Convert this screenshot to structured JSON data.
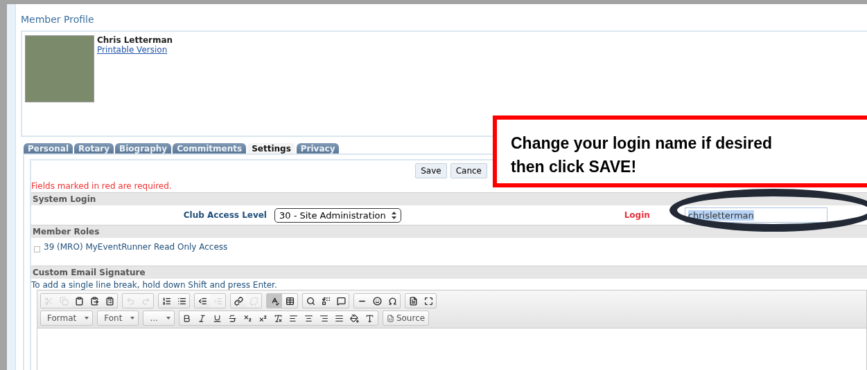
{
  "page_title": "Member Profile",
  "profile": {
    "name": "Chris Letterman",
    "link": "Printable Version"
  },
  "tabs": [
    {
      "label": "Personal",
      "selected": false
    },
    {
      "label": "Rotary",
      "selected": false
    },
    {
      "label": "Biography",
      "selected": false
    },
    {
      "label": "Commitments",
      "selected": false
    },
    {
      "label": "Settings",
      "selected": true
    },
    {
      "label": "Privacy",
      "selected": false
    }
  ],
  "buttons": [
    "Save",
    "Cance"
  ],
  "required_note": "Fields marked in red are required.",
  "sections": {
    "system_login": "System Login",
    "member_roles": "Member Roles",
    "custom_email_signature": "Custom Email Signature"
  },
  "club_access": {
    "label": "Club Access Level",
    "value": "30 - Site Administration"
  },
  "login_name": {
    "label": "Login",
    "value": "chrisletterman"
  },
  "roles": [
    {
      "label": "39 (MRO) MyEventRunner Read Only Access",
      "checked": false
    }
  ],
  "signature_hint": "To add a single line break, hold down Shift and press Enter.",
  "editor": {
    "toolbar_1": [
      [
        {
          "disabled": true,
          "pressed": false
        },
        {
          "disabled": true,
          "pressed": false
        },
        {
          "disabled": false,
          "pressed": false
        },
        {
          "disabled": false,
          "pressed": false
        },
        {
          "disabled": false,
          "pressed": false
        }
      ],
      [
        {
          "disabled": true,
          "pressed": false
        },
        {
          "disabled": true,
          "pressed": false
        }
      ],
      [
        {
          "disabled": false,
          "pressed": false
        },
        {
          "disabled": false,
          "pressed": false
        }
      ],
      [
        {
          "disabled": false,
          "pressed": false
        },
        {
          "disabled": true,
          "pressed": false
        }
      ],
      [
        {
          "disabled": false,
          "pressed": false
        },
        {
          "disabled": true,
          "pressed": false
        }
      ],
      [
        {
          "disabled": false,
          "pressed": true
        },
        {
          "disabled": false,
          "pressed": false
        }
      ],
      [
        {
          "disabled": false,
          "pressed": false
        },
        {
          "disabled": false,
          "pressed": false
        },
        {
          "disabled": false,
          "pressed": false
        }
      ],
      [
        {
          "disabled": false,
          "pressed": false
        },
        {
          "disabled": false,
          "pressed": false
        },
        {
          "disabled": false,
          "pressed": false
        }
      ],
      [
        {
          "disabled": false,
          "pressed": false
        },
        {
          "disabled": false,
          "pressed": false
        }
      ]
    ],
    "dropdowns": [
      "Format",
      "Font",
      "..."
    ],
    "source_button": "Source"
  },
  "callout": "Change your login name if desired then click SAVE!"
}
